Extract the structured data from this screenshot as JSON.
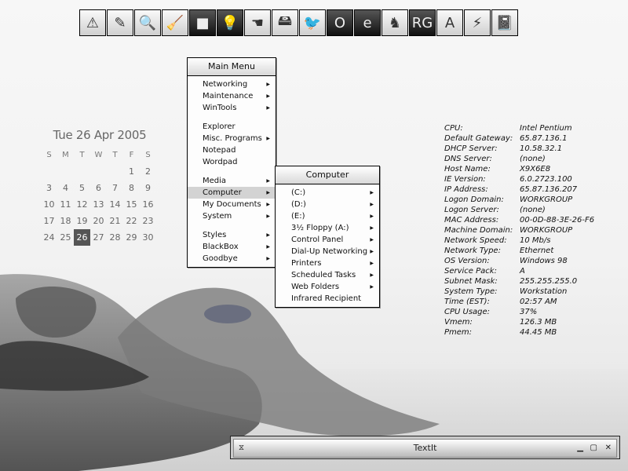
{
  "toolbar": {
    "icons": [
      {
        "name": "warning-icon",
        "glyph": "⚠"
      },
      {
        "name": "pencil-icon",
        "glyph": "✎"
      },
      {
        "name": "magnifier-icon",
        "glyph": "🔍"
      },
      {
        "name": "broom-icon",
        "glyph": "🧹"
      },
      {
        "name": "square-icon",
        "glyph": "■"
      },
      {
        "name": "lightbulb-icon",
        "glyph": "💡"
      },
      {
        "name": "hand-cursor-icon",
        "glyph": "☚"
      },
      {
        "name": "drive-icon",
        "glyph": "🖴"
      },
      {
        "name": "bird-icon",
        "glyph": "🐦"
      },
      {
        "name": "opera-icon",
        "glyph": "O"
      },
      {
        "name": "ie-icon",
        "glyph": "e"
      },
      {
        "name": "pegasus-icon",
        "glyph": "♞"
      },
      {
        "name": "rg-icon",
        "glyph": "RG"
      },
      {
        "name": "aim-icon",
        "glyph": "A"
      },
      {
        "name": "winamp-icon",
        "glyph": "⚡"
      },
      {
        "name": "notebook-icon",
        "glyph": "📓"
      }
    ]
  },
  "calendar": {
    "title": "Tue 26 Apr  2005",
    "weekdays": [
      "S",
      "M",
      "T",
      "W",
      "T",
      "F",
      "S"
    ],
    "weeks": [
      [
        "",
        "",
        "",
        "",
        "",
        "1",
        "2"
      ],
      [
        "3",
        "4",
        "5",
        "6",
        "7",
        "8",
        "9"
      ],
      [
        "10",
        "11",
        "12",
        "13",
        "14",
        "15",
        "16"
      ],
      [
        "17",
        "18",
        "19",
        "20",
        "21",
        "22",
        "23"
      ],
      [
        "24",
        "25",
        "26",
        "27",
        "28",
        "29",
        "30"
      ]
    ],
    "today": "26"
  },
  "main_menu": {
    "title": "Main Menu",
    "groups": [
      [
        {
          "label": "Networking",
          "submenu": true
        },
        {
          "label": "Maintenance",
          "submenu": true
        },
        {
          "label": "WinTools",
          "submenu": true
        }
      ],
      [
        {
          "label": "Explorer",
          "submenu": false
        },
        {
          "label": "Misc. Programs",
          "submenu": true
        },
        {
          "label": "Notepad",
          "submenu": false
        },
        {
          "label": "Wordpad",
          "submenu": false
        }
      ],
      [
        {
          "label": "Media",
          "submenu": true
        },
        {
          "label": "Computer",
          "submenu": true,
          "selected": true
        },
        {
          "label": "My Documents",
          "submenu": true
        },
        {
          "label": "System",
          "submenu": true
        }
      ],
      [
        {
          "label": "Styles",
          "submenu": true
        },
        {
          "label": "BlackBox",
          "submenu": true
        },
        {
          "label": "Goodbye",
          "submenu": true
        }
      ]
    ]
  },
  "computer_menu": {
    "title": "Computer",
    "items": [
      {
        "label": "(C:)",
        "submenu": true
      },
      {
        "label": "(D:)",
        "submenu": true
      },
      {
        "label": "(E:)",
        "submenu": true
      },
      {
        "label": "3½ Floppy (A:)",
        "submenu": true
      },
      {
        "label": "Control Panel",
        "submenu": true
      },
      {
        "label": "Dial-Up Networking",
        "submenu": true
      },
      {
        "label": "Printers",
        "submenu": true
      },
      {
        "label": "Scheduled Tasks",
        "submenu": true
      },
      {
        "label": "Web Folders",
        "submenu": true
      },
      {
        "label": "Infrared Recipient",
        "submenu": false
      }
    ]
  },
  "sysinfo": [
    {
      "key": "CPU:",
      "value": "Intel Pentium"
    },
    {
      "key": "Default Gateway:",
      "value": "65.87.136.1"
    },
    {
      "key": "DHCP Server:",
      "value": "10.58.32.1"
    },
    {
      "key": "DNS Server:",
      "value": "(none)"
    },
    {
      "key": "Host Name:",
      "value": "X9X6E8"
    },
    {
      "key": "IE Version:",
      "value": "6.0.2723.100"
    },
    {
      "key": "IP Address:",
      "value": "65.87.136.207"
    },
    {
      "key": "Logon Domain:",
      "value": "WORKGROUP"
    },
    {
      "key": "Logon Server:",
      "value": "(none)"
    },
    {
      "key": "MAC Address:",
      "value": "00-0D-88-3E-26-F6"
    },
    {
      "key": "Machine Domain:",
      "value": "WORKGROUP"
    },
    {
      "key": "Network Speed:",
      "value": "10 Mb/s"
    },
    {
      "key": "Network Type:",
      "value": "Ethernet"
    },
    {
      "key": "OS Version:",
      "value": "Windows 98"
    },
    {
      "key": "Service Pack:",
      "value": " A"
    },
    {
      "key": "Subnet Mask:",
      "value": "255.255.255.0"
    },
    {
      "key": "System Type:",
      "value": "Workstation"
    },
    {
      "key": "Time (EST):",
      "value": "02:57 AM"
    },
    {
      "key": "CPU Usage:",
      "value": "37%"
    },
    {
      "key": "Vmem:",
      "value": " 126.3 MB"
    },
    {
      "key": "Pmem:",
      "value": "44.45 MB"
    }
  ],
  "textit": {
    "title": "TextIt",
    "icon_glyph": "⧖",
    "minimize_glyph": "▁",
    "maximize_glyph": "▢",
    "close_glyph": "✕"
  }
}
